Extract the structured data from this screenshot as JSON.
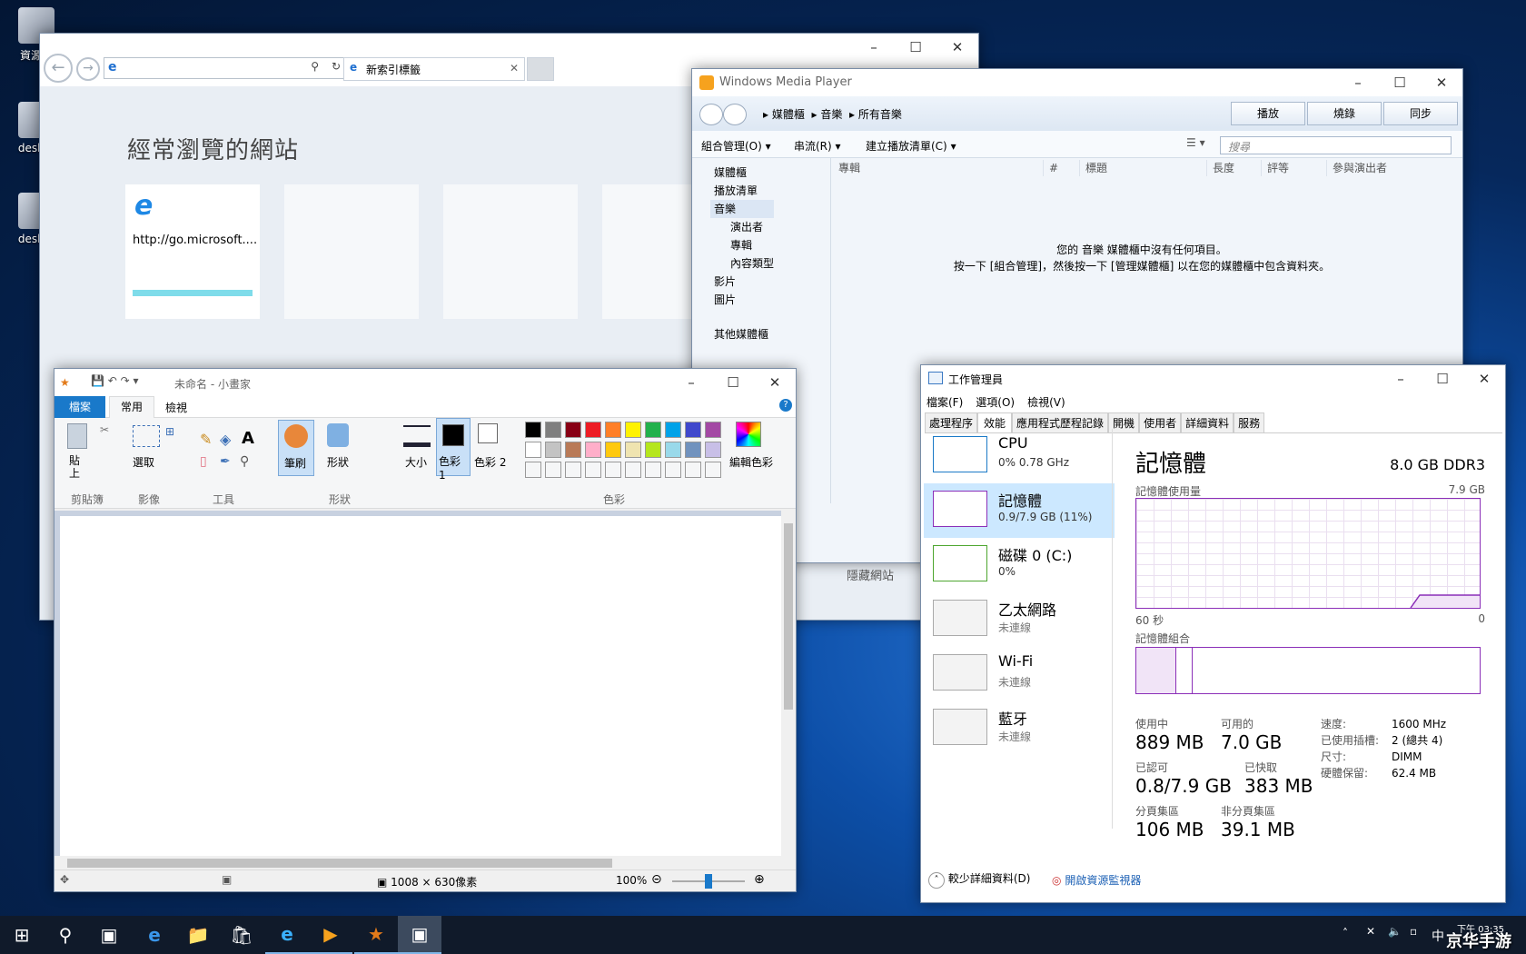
{
  "desktop": {
    "icons": [
      "資源回",
      "deskto",
      "deskto"
    ]
  },
  "ie": {
    "tab_title": "新索引標籤",
    "heading": "經常瀏覽的網站",
    "tile1_url": "http://go.microsoft....",
    "hidden_sites": "隱藏網站"
  },
  "wmp": {
    "title": "Windows Media Player",
    "breadcrumbs": [
      "媒體櫃",
      "音樂",
      "所有音樂"
    ],
    "buttons": {
      "play": "播放",
      "burn": "燒錄",
      "sync": "同步"
    },
    "menus": [
      "組合管理(O)",
      "串流(R)",
      "建立播放清單(C)"
    ],
    "search_placeholder": "搜尋",
    "tree": [
      "媒體櫃",
      "播放清單",
      "音樂",
      "演出者",
      "專輯",
      "內容類型",
      "影片",
      "圖片",
      "其他媒體櫃"
    ],
    "columns": [
      "專輯",
      "#",
      "標題",
      "長度",
      "評等",
      "參與演出者"
    ],
    "empty_line1": "您的 音樂 媒體櫃中沒有任何項目。",
    "empty_line2": "按一下 [組合管理]，然後按一下 [管理媒體櫃] 以在您的媒體櫃中包含資料夾。"
  },
  "paint": {
    "title": "未命名 - 小畫家",
    "tabs": {
      "file": "檔案",
      "home": "常用",
      "view": "檢視"
    },
    "labels": {
      "paste": "貼上",
      "select": "選取",
      "brushes": "筆刷",
      "shapes": "形狀",
      "size": "大小",
      "color1": "色彩 1",
      "color2": "色彩 2",
      "edit_colors": "編輯色彩"
    },
    "groups": {
      "clipboard": "剪貼簿",
      "image": "影像",
      "tools": "工具",
      "shapes": "形狀",
      "colors": "色彩"
    },
    "palette_row1": [
      "#000000",
      "#7f7f7f",
      "#880015",
      "#ed1c24",
      "#ff7f27",
      "#fff200",
      "#22b14c",
      "#00a2e8",
      "#3f48cc",
      "#a349a4"
    ],
    "palette_row2": [
      "#ffffff",
      "#c3c3c3",
      "#b97a57",
      "#ffaec9",
      "#ffc90e",
      "#efe4b0",
      "#b5e61d",
      "#99d9ea",
      "#7092be",
      "#c8bfe7"
    ],
    "dimensions": "1008 × 630像素",
    "zoom": "100%"
  },
  "taskmgr": {
    "title": "工作管理員",
    "menus": [
      "檔案(F)",
      "選項(O)",
      "檢視(V)"
    ],
    "tabs": [
      "處理程序",
      "效能",
      "應用程式歷程記錄",
      "開機",
      "使用者",
      "詳細資料",
      "服務"
    ],
    "side": [
      {
        "name": "CPU",
        "sub": "0% 0.78 GHz"
      },
      {
        "name": "記憶體",
        "sub": "0.9/7.9 GB (11%)"
      },
      {
        "name": "磁碟 0 (C:)",
        "sub": "0%"
      },
      {
        "name": "乙太網路",
        "sub": "未連線"
      },
      {
        "name": "Wi-Fi",
        "sub": "未連線"
      },
      {
        "name": "藍牙",
        "sub": "未連線"
      }
    ],
    "heading": "記憶體",
    "spec": "8.0 GB DDR3",
    "usage_label": "記憶體使用量",
    "usage_max": "7.9 GB",
    "axis_left": "60 秒",
    "axis_right": "0",
    "composition_label": "記憶體組合",
    "stats": {
      "in_use_label": "使用中",
      "in_use": "889 MB",
      "available_label": "可用的",
      "available": "7.0 GB",
      "committed_label": "已認可",
      "committed": "0.8/7.9 GB",
      "cached_label": "已快取",
      "cached": "383 MB",
      "paged_label": "分頁集區",
      "paged": "106 MB",
      "nonpaged_label": "非分頁集區",
      "nonpaged": "39.1 MB"
    },
    "details": {
      "speed_label": "速度:",
      "speed": "1600 MHz",
      "slots_label": "已使用插槽:",
      "slots": "2 (總共 4)",
      "form_label": "尺寸:",
      "form": "DIMM",
      "reserved_label": "硬體保留:",
      "reserved": "62.4 MB"
    },
    "fewer_details": "較少詳細資料(D)",
    "open_monitor": "開啟資源監視器"
  },
  "taskbar": {
    "ime": "中",
    "time": "下午 03:35",
    "watermark": "京华手游"
  }
}
